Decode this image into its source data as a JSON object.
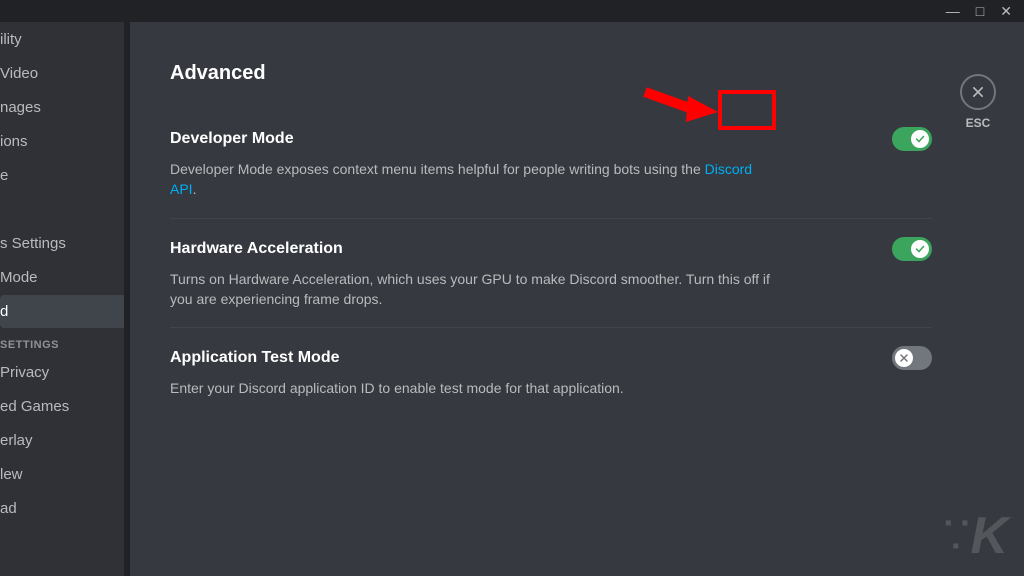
{
  "window": {
    "minimize": "—",
    "maximize": "□",
    "close": "✕"
  },
  "sidebar": {
    "items": [
      {
        "label": "ility"
      },
      {
        "label": "Video"
      },
      {
        "label": "nages"
      },
      {
        "label": "ions"
      },
      {
        "label": "e"
      },
      {
        "label": " "
      },
      {
        "label": "s Settings"
      },
      {
        "label": "Mode"
      },
      {
        "label": "d",
        "selected": true
      }
    ],
    "header": "SETTINGS",
    "items2": [
      {
        "label": "Privacy"
      },
      {
        "label": "ed Games"
      },
      {
        "label": "erlay"
      },
      {
        "label": "lew"
      },
      {
        "label": "ad"
      }
    ]
  },
  "page": {
    "title": "Advanced",
    "esc_label": "ESC"
  },
  "settings": [
    {
      "title": "Developer Mode",
      "desc_pre": "Developer Mode exposes context menu items helpful for people writing bots using the ",
      "link": "Discord API",
      "desc_post": ".",
      "toggle": "on",
      "highlight": true
    },
    {
      "title": "Hardware Acceleration",
      "desc_pre": "Turns on Hardware Acceleration, which uses your GPU to make Discord smoother. Turn this off if you are experiencing frame drops.",
      "link": "",
      "desc_post": "",
      "toggle": "on",
      "highlight": false
    },
    {
      "title": "Application Test Mode",
      "desc_pre": "Enter your Discord application ID to enable test mode for that application.",
      "link": "",
      "desc_post": "",
      "toggle": "off",
      "highlight": false
    }
  ],
  "watermark": "K"
}
